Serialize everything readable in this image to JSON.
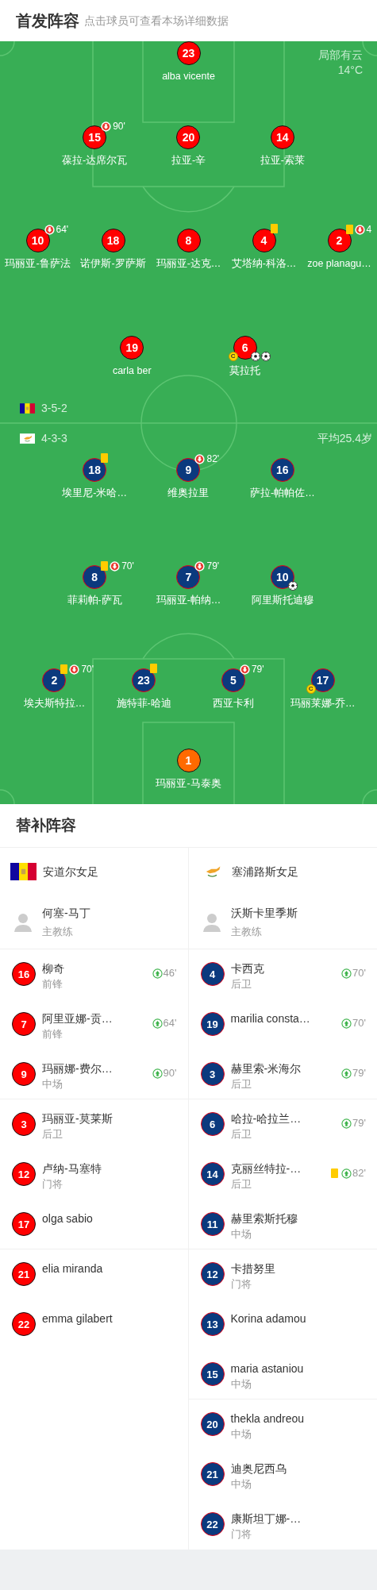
{
  "header": {
    "title": "首发阵容",
    "subtitle": "点击球员可查看本场详细数据"
  },
  "pitch": {
    "weather": "局部有云",
    "temperature": "14°C",
    "average_age": "平均25.4岁",
    "home": {
      "kind": "home",
      "flag": {
        "kind": "andorra"
      },
      "formation": "3-5-2",
      "lines": [
        [
          {
            "number": "23",
            "name": "alba vicente",
            "color": "#ff0000"
          }
        ],
        [
          {
            "number": "15",
            "name": "葆拉-达席尔瓦",
            "color": "#ff0000",
            "events": [
              {
                "kind": "sub_off",
                "minute": "90'"
              }
            ]
          },
          {
            "number": "20",
            "name": "拉亚-辛",
            "color": "#ff0000"
          },
          {
            "number": "14",
            "name": "拉亚-索莱",
            "color": "#ff0000"
          }
        ],
        [
          {
            "number": "10",
            "name": "玛丽亚-鲁萨法",
            "color": "#ff0000",
            "events": [
              {
                "kind": "sub_off",
                "minute": "64'"
              }
            ]
          },
          {
            "number": "18",
            "name": "诺伊斯-罗萨斯",
            "color": "#ff0000"
          },
          {
            "number": "8",
            "name": "玛丽亚-达克…",
            "color": "#ff0000"
          },
          {
            "number": "4",
            "name": "艾塔纳-科洛…",
            "color": "#ff0000",
            "events": [
              {
                "kind": "yellow"
              }
            ]
          },
          {
            "number": "2",
            "name": "zoe planagu…",
            "color": "#ff0000",
            "events": [
              {
                "kind": "yellow"
              },
              {
                "kind": "sub_off",
                "minute": "4"
              }
            ]
          }
        ],
        [
          {
            "number": "19",
            "name": "carla ber",
            "color": "#ff0000"
          },
          {
            "number": "6",
            "name": "莫拉托",
            "color": "#ff0000",
            "events": [
              {
                "kind": "captain",
                "label": "C"
              },
              {
                "kind": "goal"
              },
              {
                "kind": "goal"
              }
            ]
          }
        ]
      ]
    },
    "away": {
      "kind": "away",
      "flag": {
        "kind": "cyprus"
      },
      "formation": "4-3-3",
      "lines": [
        [
          {
            "number": "18",
            "name": "埃里尼-米哈…",
            "color": "#0b3a7e",
            "kind": "outfield",
            "events": [
              {
                "kind": "yellow"
              }
            ]
          },
          {
            "number": "9",
            "name": "维奥拉里",
            "color": "#0b3a7e",
            "kind": "outfield",
            "events": [
              {
                "kind": "sub_off",
                "minute": "82'"
              }
            ]
          },
          {
            "number": "16",
            "name": "萨拉-帕帕佐…",
            "color": "#0b3a7e",
            "kind": "outfield"
          }
        ],
        [
          {
            "number": "8",
            "name": "菲莉帕-萨瓦",
            "color": "#0b3a7e",
            "kind": "outfield",
            "events": [
              {
                "kind": "yellow"
              },
              {
                "kind": "sub_off",
                "minute": "70'"
              }
            ]
          },
          {
            "number": "7",
            "name": "玛丽亚-帕纳…",
            "color": "#0b3a7e",
            "kind": "outfield",
            "events": [
              {
                "kind": "sub_off",
                "minute": "79'"
              }
            ]
          },
          {
            "number": "10",
            "name": "阿里斯托迪穆",
            "color": "#0b3a7e",
            "kind": "outfield",
            "events": [
              {
                "kind": "goal"
              }
            ]
          }
        ],
        [
          {
            "number": "2",
            "name": "埃夫斯特拉…",
            "color": "#0b3a7e",
            "kind": "outfield",
            "events": [
              {
                "kind": "yellow"
              },
              {
                "kind": "sub_off",
                "minute": "70'"
              }
            ]
          },
          {
            "number": "23",
            "name": "施特菲-哈迪",
            "color": "#0b3a7e",
            "kind": "outfield",
            "events": [
              {
                "kind": "yellow"
              }
            ]
          },
          {
            "number": "5",
            "name": "西亚卡利",
            "color": "#0b3a7e",
            "kind": "outfield",
            "events": [
              {
                "kind": "sub_off",
                "minute": "79'"
              }
            ]
          },
          {
            "number": "17",
            "name": "玛丽莱娜-乔…",
            "color": "#0b3a7e",
            "kind": "outfield",
            "events": [
              {
                "kind": "captain",
                "label": "C"
              }
            ]
          }
        ],
        [
          {
            "number": "1",
            "name": "玛丽亚-马泰奥",
            "color": "#ff6a00",
            "kind": "keeper"
          }
        ]
      ]
    }
  },
  "subs": {
    "title": "替补阵容",
    "teams": [
      {
        "kind": "home",
        "flag": {
          "kind": "andorra"
        },
        "name": "安道尔女足",
        "coach": {
          "name": "何塞-马丁",
          "role": "主教练"
        },
        "players": [
          {
            "number": "16",
            "name": "柳奇",
            "position": "前锋",
            "events": [
              {
                "kind": "sub_on",
                "minute": "46'"
              }
            ]
          },
          {
            "number": "7",
            "name": "阿里亚娜-贡…",
            "position": "前锋",
            "events": [
              {
                "kind": "sub_on",
                "minute": "64'"
              }
            ]
          },
          {
            "number": "9",
            "name": "玛丽娜-费尔…",
            "position": "中场",
            "events": [
              {
                "kind": "sub_on",
                "minute": "90'"
              }
            ]
          },
          {
            "number": "3",
            "name": "玛丽亚-莫莱斯",
            "position": "后卫"
          },
          {
            "number": "12",
            "name": "卢纳-马塞特",
            "position": "门将"
          },
          {
            "number": "17",
            "name": "olga sabio"
          },
          {
            "number": "21",
            "name": "elia miranda"
          },
          {
            "number": "22",
            "name": "emma gilabert"
          }
        ]
      },
      {
        "kind": "away",
        "flag": {
          "kind": "cyprus"
        },
        "name": "塞浦路斯女足",
        "coach": {
          "name": "沃斯卡里季斯",
          "role": "主教练"
        },
        "players": [
          {
            "number": "4",
            "name": "卡西克",
            "position": "后卫",
            "events": [
              {
                "kind": "sub_on",
                "minute": "70'"
              }
            ]
          },
          {
            "number": "19",
            "name": "marilia consta…",
            "events": [
              {
                "kind": "sub_on",
                "minute": "70'"
              }
            ]
          },
          {
            "number": "3",
            "name": "赫里索-米海尔",
            "position": "后卫",
            "events": [
              {
                "kind": "sub_on",
                "minute": "79'"
              }
            ]
          },
          {
            "number": "6",
            "name": "哈拉-哈拉兰…",
            "position": "后卫",
            "events": [
              {
                "kind": "sub_on",
                "minute": "79'"
              }
            ]
          },
          {
            "number": "14",
            "name": "克丽丝特拉-…",
            "position": "后卫",
            "events": [
              {
                "kind": "yellow"
              },
              {
                "kind": "sub_on",
                "minute": "82'"
              }
            ]
          },
          {
            "number": "11",
            "name": "赫里索斯托穆",
            "position": "中场"
          },
          {
            "number": "12",
            "name": "卡措努里",
            "position": "门将"
          },
          {
            "number": "13",
            "name": "Korina adamou"
          },
          {
            "number": "15",
            "name": "maria astaniou",
            "position": "中场"
          },
          {
            "number": "20",
            "name": "thekla andreou",
            "position": "中场"
          },
          {
            "number": "21",
            "name": "迪奥尼西乌",
            "position": "中场"
          },
          {
            "number": "22",
            "name": "康斯坦丁娜-…",
            "position": "门将"
          }
        ]
      }
    ]
  }
}
